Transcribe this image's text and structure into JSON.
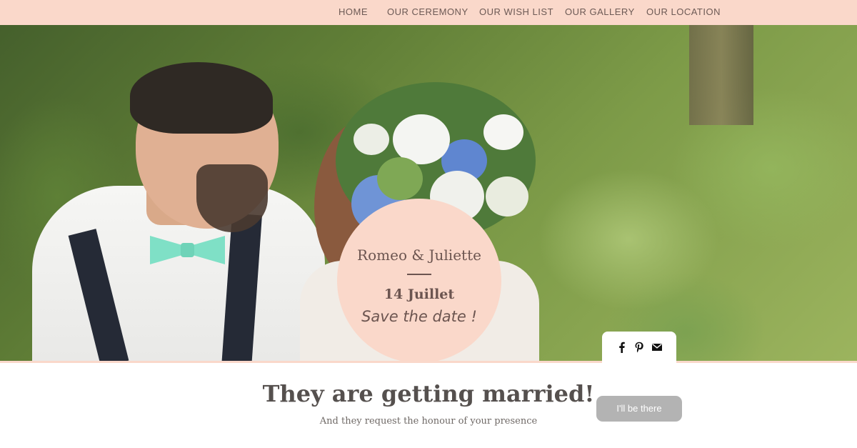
{
  "nav": {
    "items": [
      {
        "label": "HOME"
      },
      {
        "label": "OUR CEREMONY"
      },
      {
        "label": "OUR WISH LIST"
      },
      {
        "label": "OUR GALLERY"
      },
      {
        "label": "OUR LOCATION"
      }
    ]
  },
  "badge": {
    "names": "Romeo & Juliette",
    "date": "14 Juillet",
    "save_the_date": "Save the date !"
  },
  "share": {
    "icons": [
      "facebook-icon",
      "pinterest-icon",
      "mail-icon"
    ]
  },
  "main": {
    "headline": "They are getting married!",
    "subline": "And they request the honour of your presence",
    "rsvp_label": "I'll be there"
  },
  "colors": {
    "nav_background": "#fad8ca",
    "badge_background": "#fad8ca",
    "text_dark": "#55504e",
    "button_gray": "#b3b3b3"
  }
}
